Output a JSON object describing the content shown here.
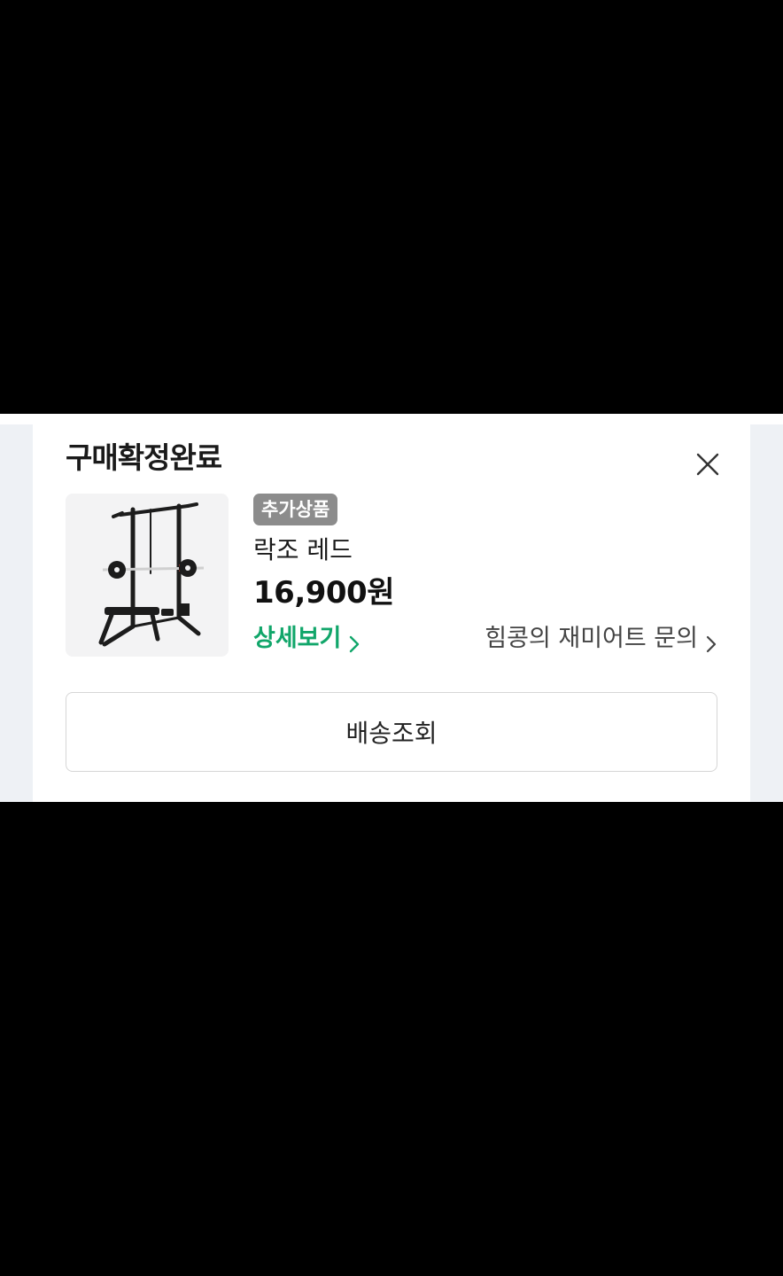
{
  "modal": {
    "title": "구매확정완료",
    "close_icon": "close-icon"
  },
  "product": {
    "image_icon": "squat-rack-image",
    "badge": "추가상품",
    "name": "락조 레드",
    "price": "16,900원",
    "detail_link": "상세보기",
    "inquiry_link": "힘콩의 재미어트 문의"
  },
  "actions": {
    "track_shipping": "배송조회"
  },
  "colors": {
    "accent_green": "#11a66a",
    "badge_gray": "#8c8c8c",
    "background": "#000000"
  }
}
